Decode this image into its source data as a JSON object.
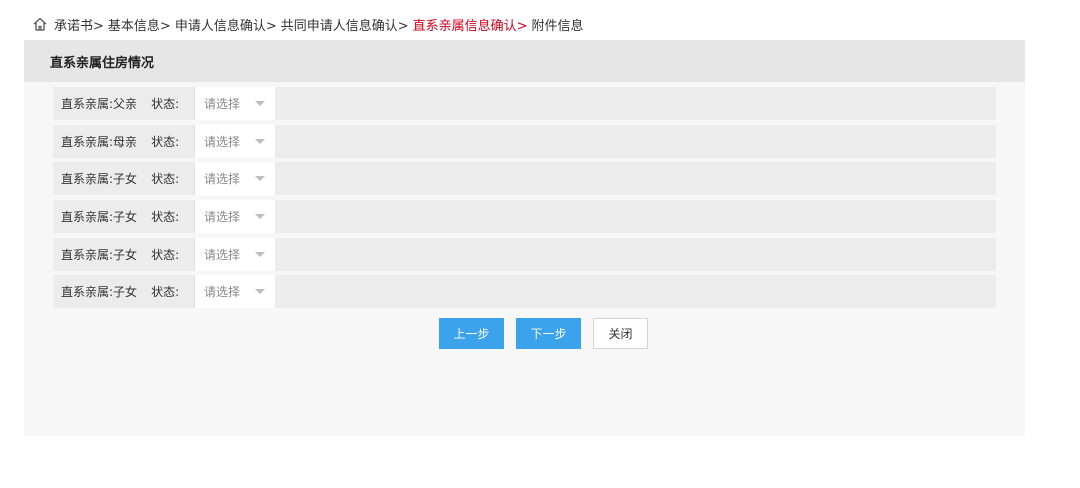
{
  "breadcrumb": {
    "items": [
      {
        "label": "承诺书>"
      },
      {
        "label": "基本信息>"
      },
      {
        "label": "申请人信息确认>"
      },
      {
        "label": "共同申请人信息确认>"
      },
      {
        "label": "直系亲属信息确认>",
        "active": true
      },
      {
        "label": "附件信息"
      }
    ],
    "icon": "home-icon",
    "active_color": "#d0021b"
  },
  "panel": {
    "title": "直系亲属住房情况"
  },
  "rows": [
    {
      "label": "直系亲属:",
      "relation": "父亲",
      "status_label": "状态:",
      "select_placeholder": "请选择"
    },
    {
      "label": "直系亲属:",
      "relation": "母亲",
      "status_label": "状态:",
      "select_placeholder": "请选择"
    },
    {
      "label": "直系亲属:",
      "relation": "子女",
      "status_label": "状态:",
      "select_placeholder": "请选择"
    },
    {
      "label": "直系亲属:",
      "relation": "子女",
      "status_label": "状态:",
      "select_placeholder": "请选择"
    },
    {
      "label": "直系亲属:",
      "relation": "子女",
      "status_label": "状态:",
      "select_placeholder": "请选择"
    },
    {
      "label": "直系亲属:",
      "relation": "子女",
      "status_label": "状态:",
      "select_placeholder": "请选择"
    }
  ],
  "actions": {
    "prev_label": "上一步",
    "next_label": "下一步",
    "close_label": "关闭",
    "primary_color": "#3aa3ec"
  }
}
